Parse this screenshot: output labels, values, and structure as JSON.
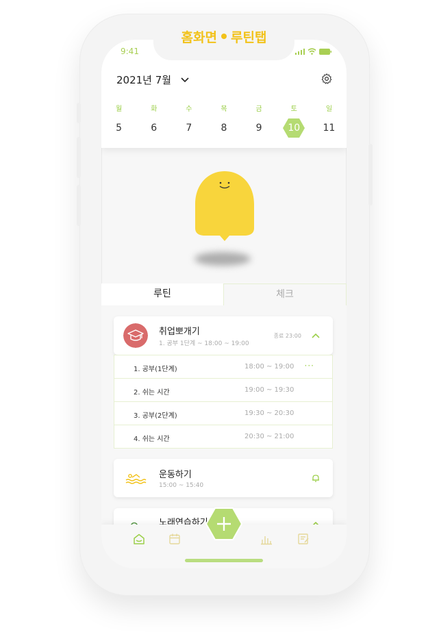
{
  "title": {
    "left": "홈화면",
    "right": "루틴탭"
  },
  "status": {
    "time": "9:41"
  },
  "calendar": {
    "month_label": "2021년 7월",
    "weekdays": [
      "월",
      "화",
      "수",
      "목",
      "금",
      "토",
      "일"
    ],
    "dates": [
      "5",
      "6",
      "7",
      "8",
      "9",
      "10",
      "11"
    ],
    "selected_index": 5
  },
  "tabs": [
    {
      "label": "루틴",
      "active": true
    },
    {
      "label": "체크",
      "active": false
    }
  ],
  "routines": [
    {
      "title": "취업뽀개기",
      "subtitle": "1. 공부 1단계 ~ 18:00 ~ 19:00",
      "end_label": "종료 23:00",
      "icon": "graduation-cap-icon",
      "expanded": true,
      "steps": [
        {
          "name": "1. 공부(1단계)",
          "time": "18:00 ~ 19:00",
          "more": "···"
        },
        {
          "name": "2. 쉬는 시간",
          "time": "19:00 ~ 19:30"
        },
        {
          "name": "3. 공부(2단계)",
          "time": "19:30 ~ 20:30"
        },
        {
          "name": "4. 쉬는 시간",
          "time": "20:30 ~ 21:00"
        }
      ]
    },
    {
      "title": "운동하기",
      "subtitle": "15:00 ~ 15:40",
      "icon": "swim-icon"
    },
    {
      "title": "노래연습하기",
      "icon": "mic-icon"
    }
  ],
  "colors": {
    "accent": "#b5db72",
    "yellow": "#f8d53c",
    "badge": "#d96b6b"
  }
}
